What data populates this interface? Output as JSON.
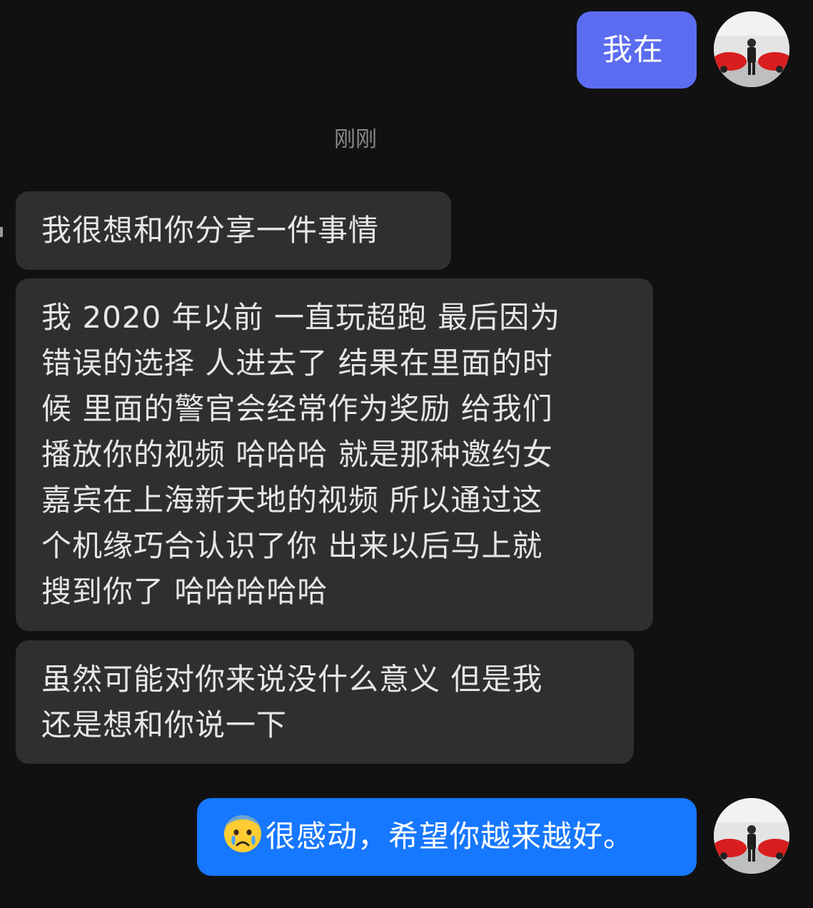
{
  "conversation": {
    "timestamp": "刚刚",
    "messages": [
      {
        "id": "m1",
        "direction": "outgoing",
        "lines": [
          "我在"
        ]
      },
      {
        "id": "m2",
        "direction": "incoming",
        "lines": [
          "我很想和你分享一件事情"
        ]
      },
      {
        "id": "m3",
        "direction": "incoming",
        "lines": [
          "我 2020 年以前 一直玩超跑 最后因为",
          "错误的选择 人进去了  结果在里面的时",
          "候 里面的警官会经常作为奖励 给我们",
          "播放你的视频 哈哈哈 就是那种邀约女",
          "嘉宾在上海新天地的视频 所以通过这",
          "个机缘巧合认识了你 出来以后马上就",
          "搜到你了 哈哈哈哈哈"
        ]
      },
      {
        "id": "m4",
        "direction": "incoming",
        "lines": [
          "虽然可能对你来说没什么意义 但是我",
          "还是想和你说一下"
        ]
      },
      {
        "id": "m5",
        "direction": "outgoing",
        "emoji": "crying-face-emoji",
        "lines": [
          "很感动，希望你越来越好。"
        ]
      }
    ]
  },
  "colors": {
    "background": "#111111",
    "incoming_bubble": "#2f2f2f",
    "outgoing_bubble_1": "#5b6cf0",
    "outgoing_bubble_2": "#1677ff",
    "text": "#e6e6e6",
    "timestamp": "#8a8a8a"
  },
  "icons": {
    "avatar": "user-avatar-photo",
    "emoji": "crying-face-emoji"
  }
}
